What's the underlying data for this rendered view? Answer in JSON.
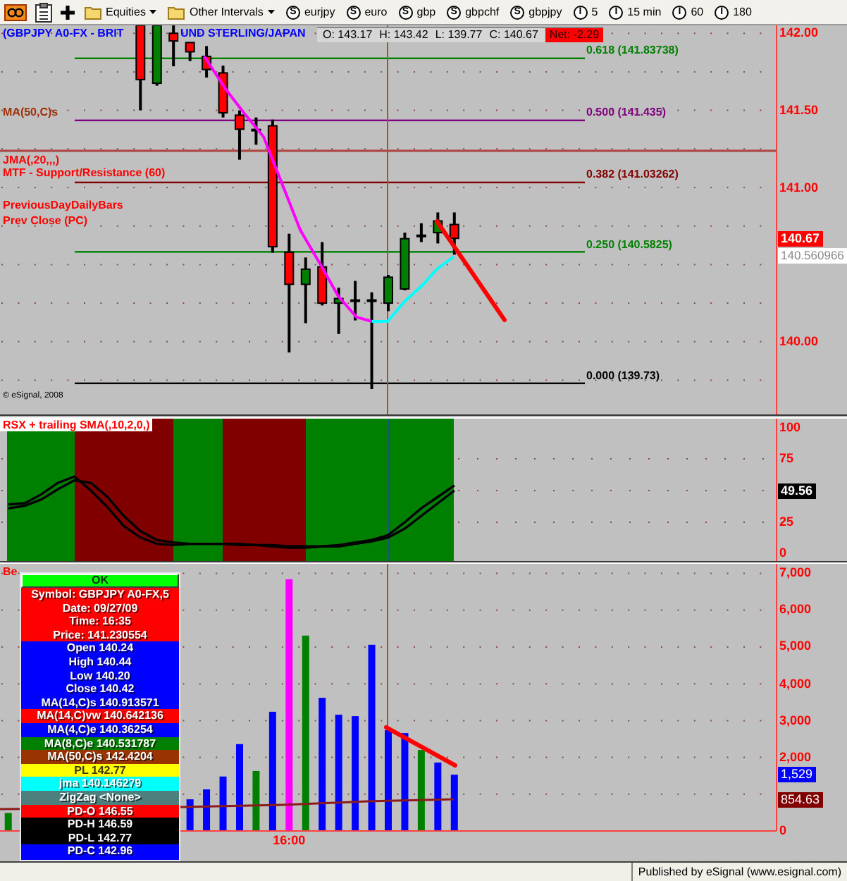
{
  "toolbar": {
    "menus": [
      {
        "label": "Equities"
      },
      {
        "label": "Other Intervals"
      }
    ],
    "shortcuts": [
      {
        "badge": "S",
        "label": "eurjpy"
      },
      {
        "badge": "S",
        "label": "euro"
      },
      {
        "badge": "S",
        "label": "gbp"
      },
      {
        "badge": "S",
        "label": "gbpchf"
      },
      {
        "badge": "S",
        "label": "gbpjpy"
      },
      {
        "badge": "I",
        "label": "5"
      },
      {
        "badge": "I",
        "label": "15 min"
      },
      {
        "badge": "I",
        "label": "60"
      },
      {
        "badge": "I",
        "label": "180"
      }
    ]
  },
  "price_panel": {
    "title_visible_parts": [
      "(GBPJPY A0-FX - BRIT",
      "UND STERLING/JAPAN"
    ],
    "quote": {
      "open": "O: 143.17",
      "high": "H: 143.42",
      "low": "L: 139.77",
      "close": "C: 140.67",
      "net": "Net: -2.29"
    },
    "studies": [
      {
        "label": "MA(50,C)s",
        "color": "#a0300a"
      },
      {
        "label": "JMA(,20,,,)",
        "color": "#ff0000"
      },
      {
        "label": "MTF - Support/Resistance (60)",
        "color": "#ff0000"
      },
      {
        "label": "PreviousDayDailyBars",
        "color": "#ff0000"
      },
      {
        "label": "Prev Close (PC)",
        "color": "#ff0000"
      }
    ],
    "fib_levels": [
      {
        "label": "0.618 (141.83738)",
        "color": "#008000"
      },
      {
        "label": "0.500 (141.435)",
        "color": "#800080"
      },
      {
        "label": "0.382 (141.03262)",
        "color": "#800000"
      },
      {
        "label": "0.250 (140.5825)",
        "color": "#008000"
      },
      {
        "label": "0.000 (139.73)",
        "color": "#000000"
      }
    ],
    "copyright": "© eSignal, 2008",
    "axis_labels": [
      "142.00",
      "141.50",
      "141.00",
      "140.00"
    ],
    "price_markers": [
      {
        "text": "140.67",
        "color": "#ff0000"
      },
      {
        "text": "140.560966",
        "color": "#ffffff"
      }
    ]
  },
  "rsx_panel": {
    "title": "RSX + trailing SMA(,10,2,0,)",
    "trend_bands": [
      {
        "color": "#008000"
      },
      {
        "color": "#800000"
      },
      {
        "color": "#008000"
      },
      {
        "color": "#800000"
      },
      {
        "color": "#008000"
      }
    ],
    "axis_labels": [
      "100",
      "75",
      "25",
      "0"
    ],
    "marker": {
      "text": "49.56",
      "color": "#000000"
    }
  },
  "volume_panel": {
    "title": "Be",
    "data_window": [
      {
        "kind": "button",
        "text": "OK",
        "color": "#00ff00"
      },
      {
        "kind": "field",
        "text": "Symbol: GBPJPY A0-FX,5",
        "color": "#ff0000"
      },
      {
        "kind": "field",
        "text": "Date: 09/27/09",
        "color": "#ff0000"
      },
      {
        "kind": "field",
        "text": "Time: 16:35",
        "color": "#ff0000"
      },
      {
        "kind": "field",
        "text": "Price: 141.230554",
        "color": "#ff0000"
      },
      {
        "kind": "field",
        "text": "Open 140.24",
        "color": "#0000ff"
      },
      {
        "kind": "field",
        "text": "High 140.44",
        "color": "#0000ff"
      },
      {
        "kind": "field",
        "text": "Low 140.20",
        "color": "#0000ff"
      },
      {
        "kind": "field",
        "text": "Close 140.42",
        "color": "#0000ff"
      },
      {
        "kind": "field",
        "text": "MA(14,C)s 140.913571",
        "color": "#0000ff"
      },
      {
        "kind": "field",
        "text": "MA(14,C)vw 140.642136",
        "color": "#ff0000"
      },
      {
        "kind": "field",
        "text": "MA(4,C)e 140.36254",
        "color": "#0000ff"
      },
      {
        "kind": "field",
        "text": "MA(8,C)e 140.531787",
        "color": "#008000"
      },
      {
        "kind": "field",
        "text": "MA(50,C)s 142.4204",
        "color": "#993300"
      },
      {
        "kind": "field",
        "text": "PL 142.77",
        "color": "#ffff00"
      },
      {
        "kind": "field",
        "text": "jma 140.146279",
        "color": "#00ffff"
      },
      {
        "kind": "field",
        "text": "ZigZag <None>",
        "color": "#4d7f7f"
      },
      {
        "kind": "field",
        "text": "PD-O 146.55",
        "color": "#ff0000"
      },
      {
        "kind": "field",
        "text": "PD-H 146.59",
        "color": "#000000"
      },
      {
        "kind": "field",
        "text": "PD-L 142.77",
        "color": "#000000"
      },
      {
        "kind": "field",
        "text": "PD-C 142.96",
        "color": "#0000ff"
      }
    ],
    "axis_labels": [
      "7,000",
      "6,000",
      "5,000",
      "4,000",
      "3,000",
      "2,000",
      "0"
    ],
    "markers": [
      {
        "text": "1,529",
        "color": "#0000ff"
      },
      {
        "text": "854.63",
        "color": "#800000"
      }
    ],
    "time_label": "16:00",
    "bar_colors": [
      {
        "color": "#008000"
      },
      {
        "color": "#0000ff"
      },
      {
        "color": "#0000ff"
      },
      {
        "color": "#0000ff"
      },
      {
        "color": "#0000ff"
      },
      {
        "color": "#008000"
      },
      {
        "color": "#0000ff"
      },
      {
        "color": "#ff00ff"
      },
      {
        "color": "#008000"
      },
      {
        "color": "#0000ff"
      },
      {
        "color": "#0000ff"
      },
      {
        "color": "#0000ff"
      },
      {
        "color": "#0000ff"
      },
      {
        "color": "#0000ff"
      },
      {
        "color": "#0000ff"
      },
      {
        "color": "#008000"
      },
      {
        "color": "#0000ff"
      },
      {
        "color": "#0000ff"
      }
    ]
  },
  "status_bar": {
    "credit": "Published by eSignal (www.esignal.com)"
  }
}
